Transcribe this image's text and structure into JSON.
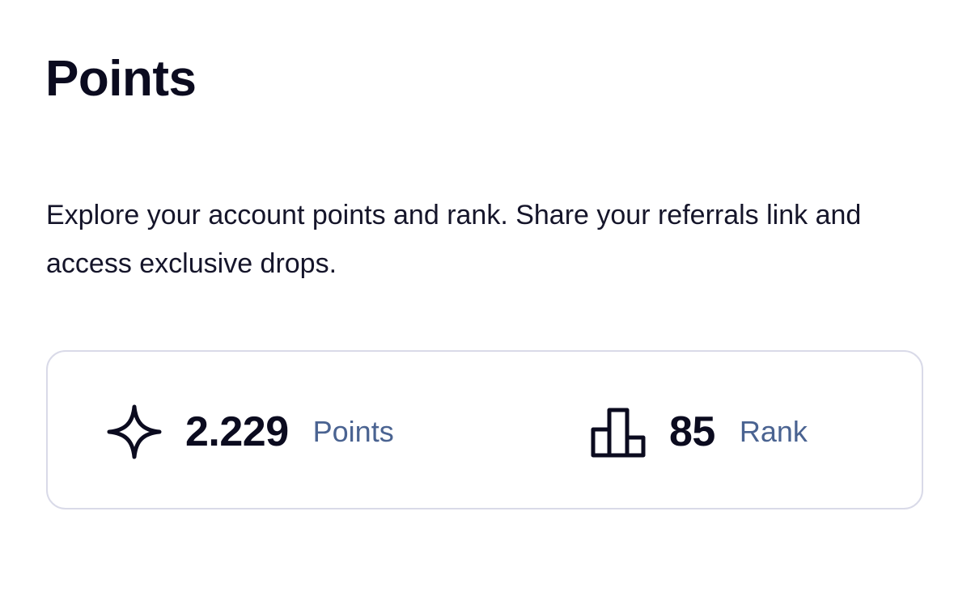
{
  "page": {
    "title": "Points",
    "description": "Explore your account points and rank. Share your referrals link and access exclusive drops."
  },
  "stats": {
    "points": {
      "icon": "sparkle-icon",
      "value": "2.229",
      "label": "Points"
    },
    "rank": {
      "icon": "leaderboard-icon",
      "value": "85",
      "label": "Rank"
    }
  },
  "colors": {
    "text": "#0b0b1f",
    "label": "#4a6391",
    "card_border": "#d9dae8"
  }
}
